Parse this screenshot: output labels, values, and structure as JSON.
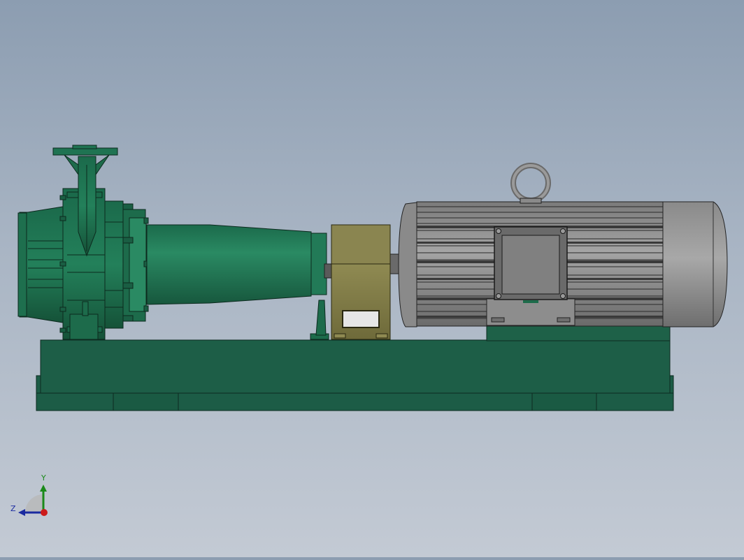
{
  "viewport": {
    "model_description": "pump-motor-assembly",
    "colors": {
      "background_top": "#8c9db1",
      "background_bottom": "#c3cad4",
      "pump_green": "#1f7352",
      "pump_green_light": "#2a8a63",
      "pump_green_dark": "#16573d",
      "base_green": "#1c5c46",
      "coupling_guard": "#807a45",
      "motor_grey": "#8f8f8f",
      "motor_dark": "#4a4a4a"
    },
    "components": {
      "base_frame": "base-frame",
      "pump_casing": "pump-casing",
      "suction_cone": "suction-cone",
      "discharge_flange": "discharge-flange",
      "coupling_guard": "coupling-guard",
      "motor_body": "motor-body",
      "lifting_eye": "lifting-eye",
      "terminal_box": "terminal-box",
      "motor_end_cap": "motor-end-cap"
    }
  },
  "triad": {
    "x_label": "",
    "y_label": "Y",
    "z_label": "Z",
    "y_color": "#1a8a1a",
    "z_color": "#1a2aa0",
    "x_color": "#cc1a1a"
  }
}
